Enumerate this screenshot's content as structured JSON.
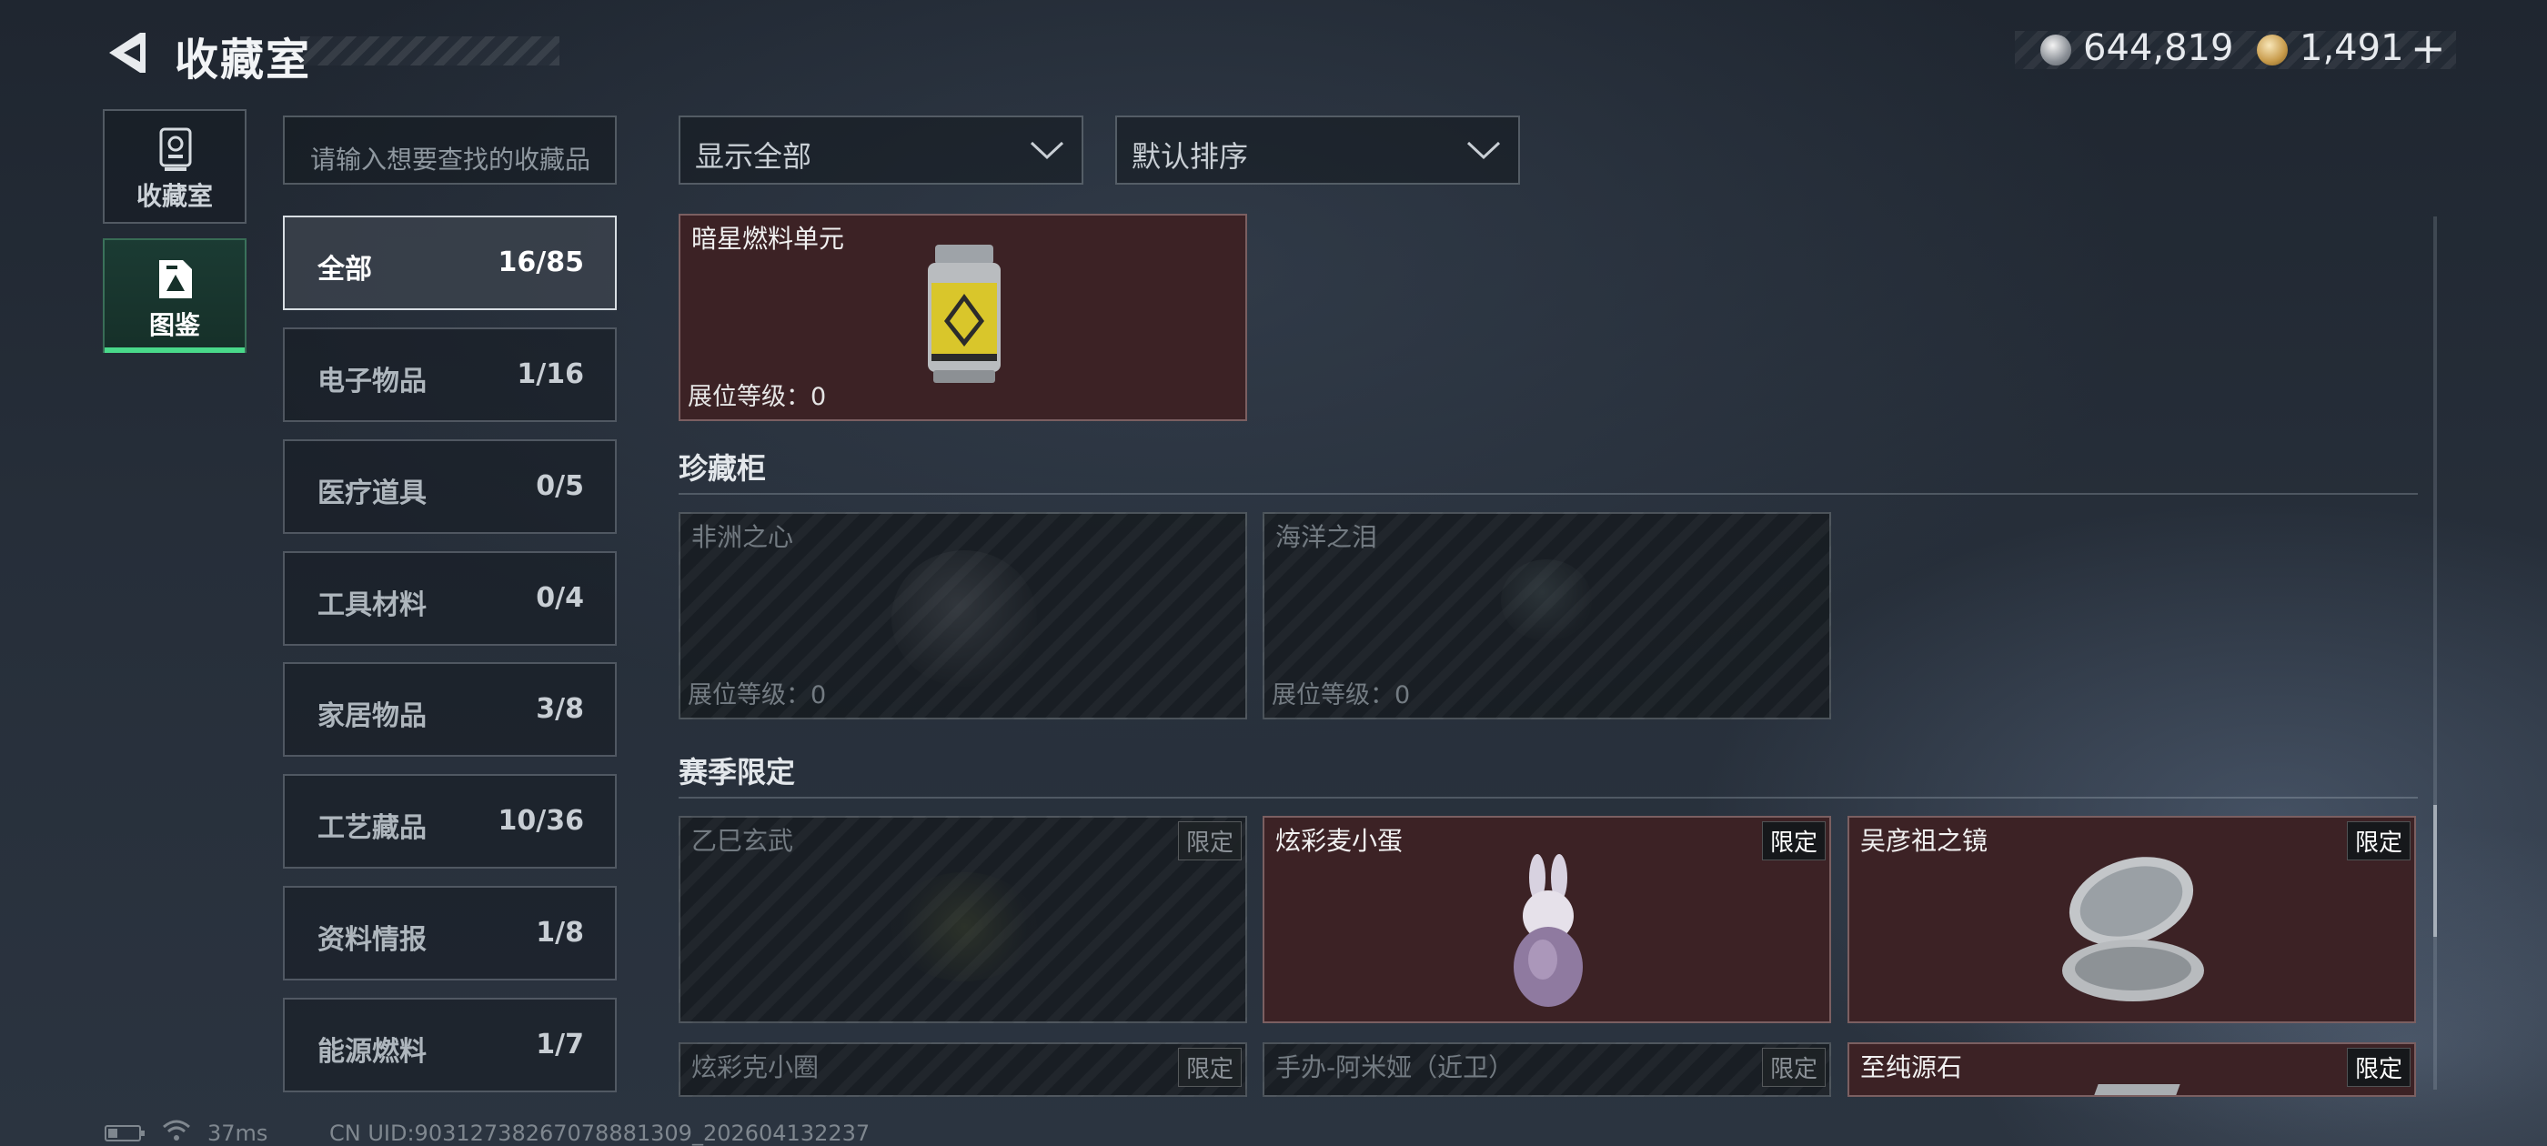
{
  "header": {
    "title": "收藏室",
    "currency": [
      {
        "icon": "silver-coin-icon",
        "value": "644,819"
      },
      {
        "icon": "gold-coin-icon",
        "value": "1,491"
      }
    ],
    "plus_label": "+"
  },
  "nav": [
    {
      "label": "收藏室",
      "icon": "trophy-icon",
      "active": false
    },
    {
      "label": "图鉴",
      "icon": "catalog-icon",
      "active": true
    }
  ],
  "search": {
    "placeholder": "请输入想要查找的收藏品"
  },
  "categories": [
    {
      "label": "全部",
      "count": "16/85",
      "active": true
    },
    {
      "label": "电子物品",
      "count": "1/16"
    },
    {
      "label": "医疗道具",
      "count": "0/5"
    },
    {
      "label": "工具材料",
      "count": "0/4"
    },
    {
      "label": "家居物品",
      "count": "3/8"
    },
    {
      "label": "工艺藏品",
      "count": "10/36"
    },
    {
      "label": "资料情报",
      "count": "1/8"
    },
    {
      "label": "能源燃料",
      "count": "1/7"
    }
  ],
  "filters": {
    "show": "显示全部",
    "sort": "默认排序"
  },
  "sections": {
    "top_item": {
      "name": "暗星燃料单元",
      "level": "展位等级：0",
      "owned": true
    },
    "cabinet": {
      "title": "珍藏柜",
      "items": [
        {
          "name": "非洲之心",
          "level": "展位等级：0",
          "owned": false
        },
        {
          "name": "海洋之泪",
          "level": "展位等级：0",
          "owned": false
        }
      ]
    },
    "season": {
      "title": "赛季限定",
      "badge": "限定",
      "items": [
        {
          "name": "乙巳玄武",
          "owned": false
        },
        {
          "name": "炫彩麦小蛋",
          "owned": true
        },
        {
          "name": "吴彦祖之镜",
          "owned": true
        },
        {
          "name": "炫彩克小圈",
          "owned": false
        },
        {
          "name": "手办-阿米娅（近卫）",
          "owned": false
        },
        {
          "name": "至纯源石",
          "owned": true
        }
      ]
    }
  },
  "footer": {
    "ping": "37ms",
    "uid": "CN UID:903127382670788813​09_202604132237"
  },
  "colors": {
    "accent": "#49d98a",
    "owned_card": "#3c2225",
    "background": "#262e39"
  }
}
